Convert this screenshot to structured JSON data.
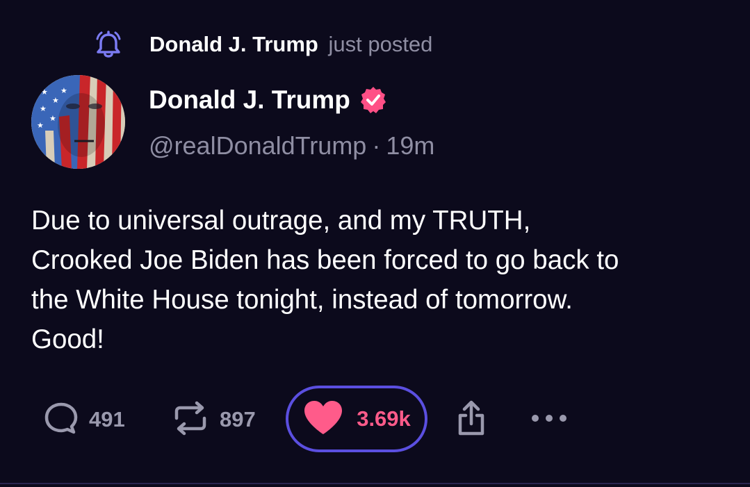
{
  "notification": {
    "icon": "bell-icon",
    "actor": "Donald J. Trump",
    "action": "just posted"
  },
  "author": {
    "name": "Donald J. Trump",
    "handle": "@realDonaldTrump",
    "separator": "·",
    "time": "19m",
    "verified_icon": "verified-badge-icon",
    "verified_color": "#ff4f86"
  },
  "post": {
    "lines": [
      "Due to universal outrage, and my TRUTH,",
      "Crooked Joe Biden has been forced to go back to",
      "the White House tonight, instead of tomorrow.",
      "Good!"
    ]
  },
  "actions": {
    "replies": "491",
    "reposts": "897",
    "likes": "3.69k",
    "like_color": "#ff5b8a",
    "like_border_color": "#5b4fe0"
  },
  "colors": {
    "background": "#0c0a1c",
    "muted_text": "#8f8ea3",
    "bell_accent": "#7b7bf2"
  }
}
